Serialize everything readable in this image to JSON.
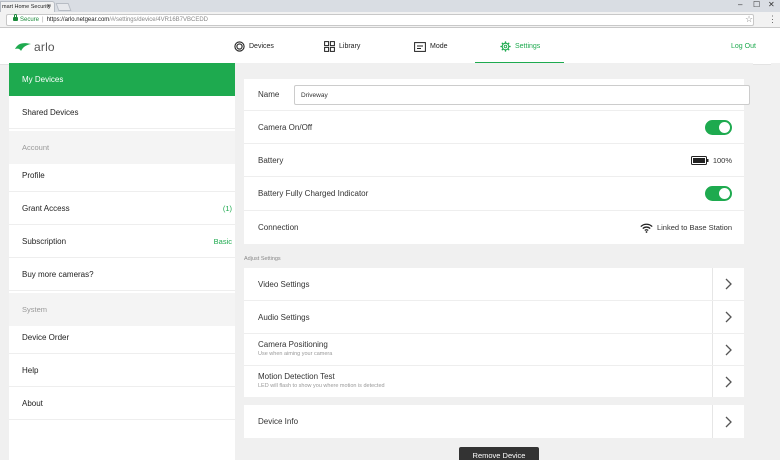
{
  "browser": {
    "tab_title": "mart Home Security",
    "tab_close": "×",
    "window_controls": [
      "–",
      "☐",
      "✕"
    ],
    "secure_label": "Secure",
    "url_host": "https://arlo.netgear.com",
    "url_path": "/#/settings/device/4VR16B7VBCEDD",
    "url_separator": "|"
  },
  "header": {
    "logo_text": "arlo",
    "nav": [
      {
        "label": "Devices",
        "icon": "devices-icon"
      },
      {
        "label": "Library",
        "icon": "library-grid-icon"
      },
      {
        "label": "Mode",
        "icon": "mode-icon"
      },
      {
        "label": "Settings",
        "icon": "gear-icon",
        "active": true
      }
    ],
    "logout_label": "Log Out"
  },
  "sidebar": {
    "items": [
      {
        "label": "My Devices",
        "active": true
      },
      {
        "label": "Shared Devices"
      }
    ],
    "account_header": "Account",
    "account_items": [
      {
        "label": "Profile",
        "value": ""
      },
      {
        "label": "Grant Access",
        "value": "(1)"
      },
      {
        "label": "Subscription",
        "value": "Basic"
      },
      {
        "label": "Buy more cameras?",
        "value": ""
      }
    ],
    "system_header": "System",
    "system_items": [
      {
        "label": "Device Order"
      },
      {
        "label": "Help"
      },
      {
        "label": "About"
      }
    ]
  },
  "device": {
    "name_label": "Name",
    "name_value": "Driveway",
    "camera_onoff_label": "Camera On/Off",
    "camera_on": true,
    "battery_label": "Battery",
    "battery_value": "100%",
    "battery_level": 1.0,
    "charged_indicator_label": "Battery Fully Charged Indicator",
    "charged_indicator_on": true,
    "connection_label": "Connection",
    "connection_value": "Linked to Base Station"
  },
  "adjust": {
    "section_label": "Adjust Settings",
    "video_label": "Video Settings",
    "audio_label": "Audio Settings",
    "positioning_label": "Camera Positioning",
    "positioning_sub": "Use when aiming your camera",
    "motion_label": "Motion Detection Test",
    "motion_sub": "LED will flash to show you where motion is detected"
  },
  "info": {
    "device_info_label": "Device Info"
  },
  "remove_button_label": "Remove Device",
  "colors": {
    "accent": "#1eaa4f",
    "remove_button": "#333333"
  }
}
